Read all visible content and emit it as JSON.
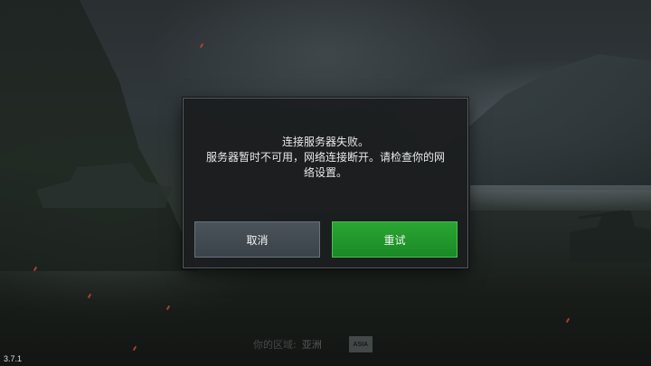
{
  "dialog": {
    "message_lines": [
      "连接服务器失败。",
      "服务器暂时不可用，网络连接断开。请检查你的网",
      "络设置。"
    ],
    "cancel_label": "取消",
    "retry_label": "重试"
  },
  "footer": {
    "region_label": "你的区域:",
    "region_value": "亚洲",
    "region_badge": "ASIA",
    "version": "3.7.1"
  },
  "colors": {
    "retry_button": "#1f9a2a",
    "cancel_button": "#434b52",
    "dialog_bg": "#1b1e1f"
  }
}
